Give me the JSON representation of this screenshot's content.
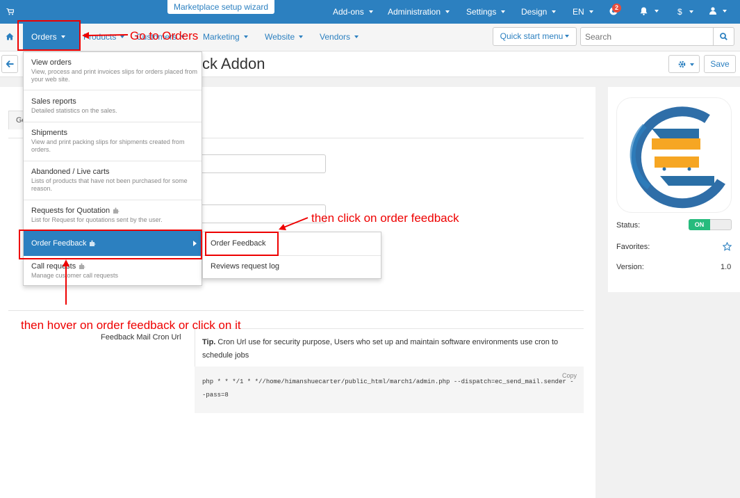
{
  "topbar": {
    "wizard": "Marketplace setup wizard",
    "nav": [
      "Add-ons",
      "Administration",
      "Settings",
      "Design",
      "EN"
    ],
    "notifications_count": "2",
    "currency": "$"
  },
  "navbar": {
    "orders": "Orders",
    "products": "Products",
    "customers": "Customers",
    "marketing": "Marketing",
    "website": "Website",
    "vendors": "Vendors",
    "quick_start": "Quick start menu",
    "search_placeholder": "Search"
  },
  "header": {
    "title": "ck Addon",
    "save": "Save"
  },
  "tabs": {
    "general_partial": "Ge"
  },
  "orders_menu": [
    {
      "title": "View orders",
      "desc": "View, process and print invoices slips for orders placed from your web site."
    },
    {
      "title": "Sales reports",
      "desc": "Detailed statistics on the sales."
    },
    {
      "title": "Shipments",
      "desc": "View and print packing slips for shipments created from orders."
    },
    {
      "title": "Abandoned / Live carts",
      "desc": "Lists of products that have not been purchased for some reason."
    },
    {
      "title": "Requests for Quotation",
      "desc": "List for Request for quotations sent by the user."
    },
    {
      "title": "Order Feedback",
      "desc": ""
    },
    {
      "title": "Call requests",
      "desc": "Manage customer call requests"
    }
  ],
  "submenu": [
    "Order Feedback",
    "Reviews request log"
  ],
  "form": {
    "cron_label": "Feedback Mail Cron Url",
    "tip_bold": "Tip.",
    "tip_text": "Cron Url use for security purpose, Users who set up and maintain software environments use cron to schedule jobs",
    "code": "php * * */1 * *//home/himanshuecarter/public_html/march1/admin.php --dispatch=ec_send_mail.sender --pass=8",
    "copy": "Copy"
  },
  "sidebar": {
    "status_label": "Status:",
    "status_value": "ON",
    "favorites_label": "Favorites:",
    "version_label": "Version:",
    "version_value": "1.0"
  },
  "annotations": {
    "go_to_orders": "Go to Orders",
    "click_feedback": "then click on order feedback",
    "hover_feedback": "then hover on order feedback or click on it"
  },
  "colors": {
    "primary": "#2c80c0",
    "annotation": "#e00000",
    "status_on": "#26bb7d"
  }
}
